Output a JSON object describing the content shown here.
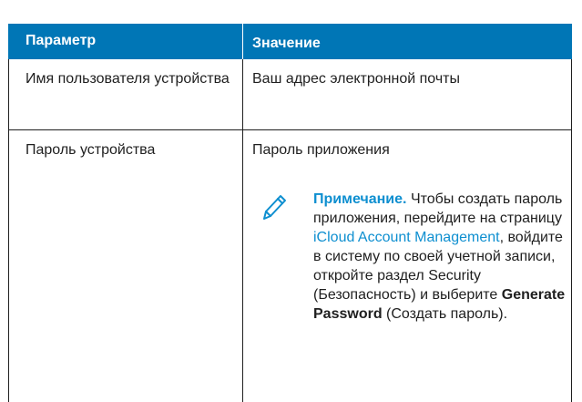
{
  "table": {
    "header": {
      "param": "Параметр",
      "value": "Значение"
    },
    "rows": [
      {
        "param": "Имя пользователя устройства",
        "value": "Ваш адрес электронной почты"
      },
      {
        "param": "Пароль устройства",
        "value": "Пароль приложения"
      }
    ],
    "note": {
      "label": "Примечание.",
      "text_1": "Чтобы создать пароль приложения, перейдите на страницу",
      "link": "iCloud Account Management",
      "text_2": ", войдите в систему по своей учетной записи, откройте раздел Security (Безопасность) и выберите",
      "bold": "Generate Password",
      "text_3": "(Создать пароль)."
    }
  },
  "colors": {
    "header_bg": "#0076b6",
    "accent": "#0e8fd0",
    "text": "#1f1f1f"
  },
  "icons": {
    "note": "pencil-icon"
  }
}
